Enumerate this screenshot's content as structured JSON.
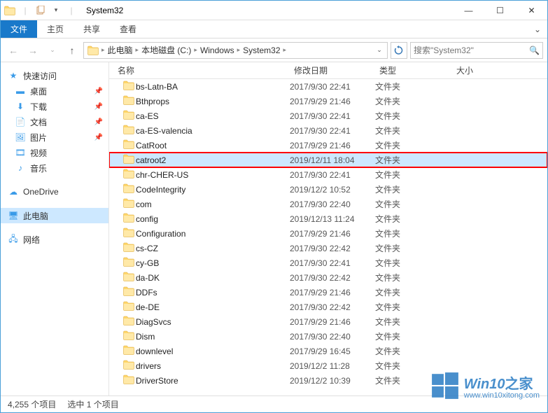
{
  "window": {
    "title": "System32",
    "min": "—",
    "max": "☐",
    "close": "✕"
  },
  "ribbon": {
    "file": "文件",
    "home": "主页",
    "share": "共享",
    "view": "查看"
  },
  "address": {
    "crumbs": [
      "此电脑",
      "本地磁盘 (C:)",
      "Windows",
      "System32"
    ]
  },
  "search": {
    "placeholder": "搜索\"System32\""
  },
  "sidebar": {
    "quick": "快速访问",
    "desktop": "桌面",
    "downloads": "下载",
    "documents": "文档",
    "pictures": "图片",
    "videos": "视频",
    "music": "音乐",
    "onedrive": "OneDrive",
    "thispc": "此电脑",
    "network": "网络"
  },
  "columns": {
    "name": "名称",
    "date": "修改日期",
    "type": "类型",
    "size": "大小"
  },
  "files": [
    {
      "name": "bs-Latn-BA",
      "date": "2017/9/30 22:41",
      "type": "文件夹"
    },
    {
      "name": "Bthprops",
      "date": "2017/9/29 21:46",
      "type": "文件夹"
    },
    {
      "name": "ca-ES",
      "date": "2017/9/30 22:41",
      "type": "文件夹"
    },
    {
      "name": "ca-ES-valencia",
      "date": "2017/9/30 22:41",
      "type": "文件夹"
    },
    {
      "name": "CatRoot",
      "date": "2017/9/29 21:46",
      "type": "文件夹"
    },
    {
      "name": "catroot2",
      "date": "2019/12/11 18:04",
      "type": "文件夹",
      "selected": true,
      "highlighted": true
    },
    {
      "name": "chr-CHER-US",
      "date": "2017/9/30 22:41",
      "type": "文件夹"
    },
    {
      "name": "CodeIntegrity",
      "date": "2019/12/2 10:52",
      "type": "文件夹"
    },
    {
      "name": "com",
      "date": "2017/9/30 22:40",
      "type": "文件夹"
    },
    {
      "name": "config",
      "date": "2019/12/13 11:24",
      "type": "文件夹"
    },
    {
      "name": "Configuration",
      "date": "2017/9/29 21:46",
      "type": "文件夹"
    },
    {
      "name": "cs-CZ",
      "date": "2017/9/30 22:42",
      "type": "文件夹"
    },
    {
      "name": "cy-GB",
      "date": "2017/9/30 22:41",
      "type": "文件夹"
    },
    {
      "name": "da-DK",
      "date": "2017/9/30 22:42",
      "type": "文件夹"
    },
    {
      "name": "DDFs",
      "date": "2017/9/29 21:46",
      "type": "文件夹"
    },
    {
      "name": "de-DE",
      "date": "2017/9/30 22:42",
      "type": "文件夹"
    },
    {
      "name": "DiagSvcs",
      "date": "2017/9/29 21:46",
      "type": "文件夹"
    },
    {
      "name": "Dism",
      "date": "2017/9/30 22:40",
      "type": "文件夹"
    },
    {
      "name": "downlevel",
      "date": "2017/9/29 16:45",
      "type": "文件夹"
    },
    {
      "name": "drivers",
      "date": "2019/12/2 11:28",
      "type": "文件夹"
    },
    {
      "name": "DriverStore",
      "date": "2019/12/2 10:39",
      "type": "文件夹"
    }
  ],
  "status": {
    "total": "4,255 个项目",
    "selected": "选中 1 个项目"
  },
  "watermark": {
    "brand_prefix": "Win10",
    "brand_suffix": "之家",
    "url": "www.win10xitong.com"
  }
}
